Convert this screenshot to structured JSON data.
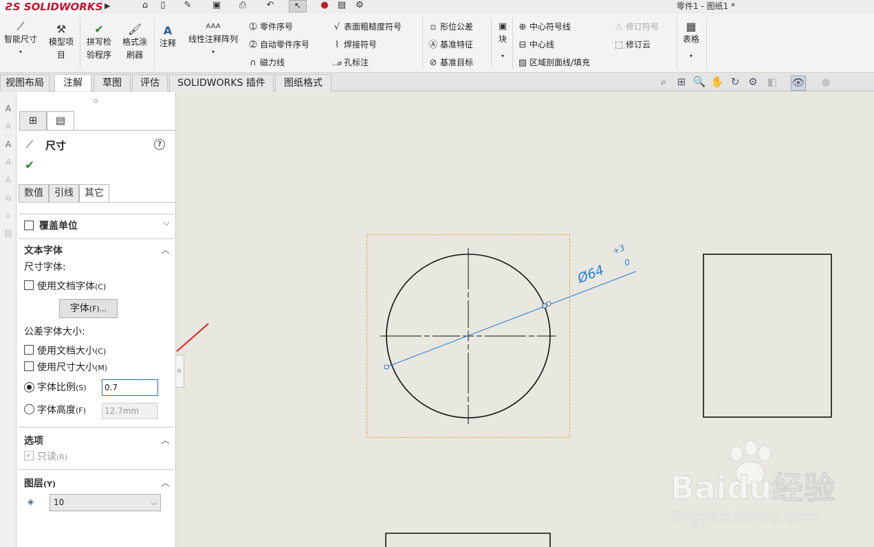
{
  "app": {
    "logo": "SOLIDWORKS",
    "document_title": "零件1 - 图纸1 *"
  },
  "quick_access": {
    "icons": [
      "home-icon",
      "new-doc-icon",
      "open-icon",
      "save-icon",
      "print-icon",
      "undo-icon",
      "select-pointer-icon",
      "rebuild-icon",
      "file-properties-icon",
      "options-gear-icon"
    ]
  },
  "ribbon": {
    "smart_dimension": "智能尺寸",
    "model_items": [
      "模型项",
      "目"
    ],
    "spell_checker": [
      "拼写检",
      "验程序"
    ],
    "format_painter": [
      "格式涂",
      "刷器"
    ],
    "note": "注释",
    "linear_note_pattern": "线性注释阵列",
    "balloon": "零件序号",
    "auto_balloon": "自动零件序号",
    "magnetic_line": "磁力线",
    "surface_finish": "表面粗糙度符号",
    "weld_symbol": "焊接符号",
    "hole_callout": "孔标注",
    "geometric_tolerance": "形位公差",
    "datum_feature": "基准特征",
    "datum_target": "基准目标",
    "block": "块",
    "centermark": "中心符号线",
    "centerline": "中心线",
    "area_hatch": "区域剖面线/填充",
    "revision_symbol": "修订符号",
    "revision_cloud": "修订云",
    "table": "表格"
  },
  "tabs": [
    {
      "label": "视图布局",
      "active": false
    },
    {
      "label": "注解",
      "active": true
    },
    {
      "label": "草图",
      "active": false
    },
    {
      "label": "评估",
      "active": false
    },
    {
      "label": "SOLIDWORKS 插件",
      "active": false
    },
    {
      "label": "图纸格式",
      "active": false
    }
  ],
  "property_manager": {
    "title": "尺寸",
    "sub_tabs": [
      {
        "label": "数值",
        "active": false
      },
      {
        "label": "引线",
        "active": false
      },
      {
        "label": "其它",
        "active": true
      }
    ],
    "override_units": {
      "label": "覆盖单位",
      "checked": false
    },
    "text_fonts": {
      "title": "文本字体",
      "dimension_font_label": "尺寸字体:",
      "use_doc_font": {
        "label": "使用文档字体",
        "hotkey": "(C)",
        "checked": false
      },
      "font_button": {
        "label": "字体",
        "hotkey": "(F)..."
      },
      "tolerance_font_label": "公差字体大小:",
      "use_doc_size": {
        "label": "使用文档大小",
        "hotkey": "(C)",
        "checked": false
      },
      "use_dim_size": {
        "label": "使用尺寸大小",
        "hotkey": "(M)",
        "checked": false
      },
      "font_scale": {
        "label": "字体比例",
        "hotkey": "(S)",
        "selected": true,
        "value": "0.7"
      },
      "font_height": {
        "label": "字体高度",
        "hotkey": "(F)",
        "selected": false,
        "value": "12.7mm"
      }
    },
    "options": {
      "title": "选项",
      "read_only": {
        "label": "只读",
        "hotkey": "(R)",
        "checked": true
      }
    },
    "layer": {
      "title": "图层",
      "hotkey": "(Y)",
      "value": "10"
    }
  },
  "drawing": {
    "dimension_text": "Ø64",
    "tolerance_upper": "+3",
    "tolerance_lower": "0"
  },
  "watermark": {
    "brand": "Baidu经验",
    "url": "jingyan.baidu.com"
  },
  "colors": {
    "canvas_bg": "#e8e7e0",
    "dimension_blue": "#2f7fd0",
    "selection_orange": "#f0a030",
    "annotation_red": "#e0201a",
    "ok_green": "#2f8a2f",
    "logo_red": "#c8102e"
  }
}
